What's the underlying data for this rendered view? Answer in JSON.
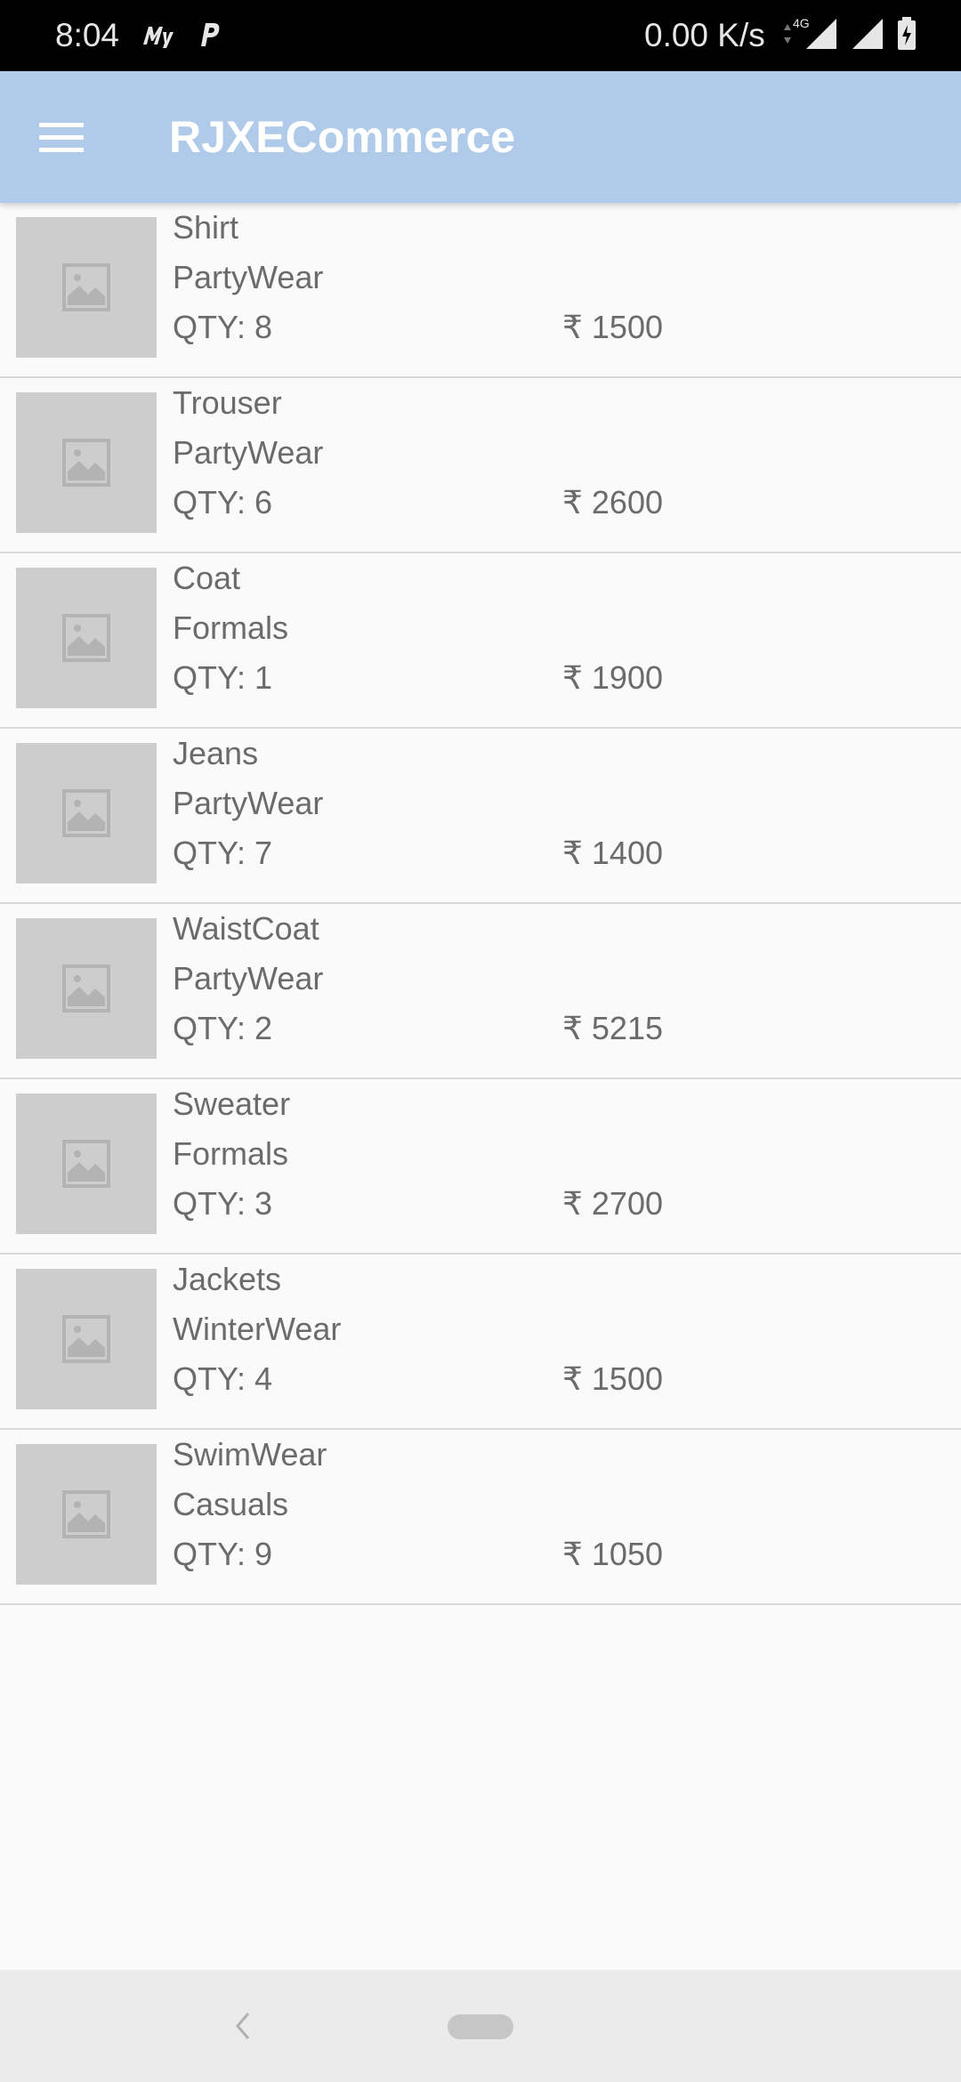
{
  "status_bar": {
    "time": "8:04",
    "network_speed": "0.00 K/s",
    "network_type": "4G",
    "icons": [
      "my-app-icon",
      "p-icon",
      "signal-4g-icon",
      "signal-icon",
      "battery-charging-icon"
    ]
  },
  "app_bar": {
    "title": "RJXECommerce",
    "menu_icon": "hamburger-menu-icon",
    "background": "#b0cbe9"
  },
  "products": [
    {
      "name": "Shirt",
      "category": "PartyWear",
      "qty": "QTY: 8",
      "price": "₹ 1500",
      "image_icon": "image-placeholder-icon"
    },
    {
      "name": "Trouser",
      "category": "PartyWear",
      "qty": "QTY: 6",
      "price": "₹ 2600",
      "image_icon": "image-placeholder-icon"
    },
    {
      "name": "Coat",
      "category": "Formals",
      "qty": "QTY: 1",
      "price": "₹ 1900",
      "image_icon": "image-placeholder-icon"
    },
    {
      "name": "Jeans",
      "category": "PartyWear",
      "qty": "QTY: 7",
      "price": "₹ 1400",
      "image_icon": "image-placeholder-icon"
    },
    {
      "name": "WaistCoat",
      "category": "PartyWear",
      "qty": "QTY: 2",
      "price": "₹ 5215",
      "image_icon": "image-placeholder-icon"
    },
    {
      "name": "Sweater",
      "category": "Formals",
      "qty": "QTY: 3",
      "price": "₹ 2700",
      "image_icon": "image-placeholder-icon"
    },
    {
      "name": "Jackets",
      "category": "WinterWear",
      "qty": "QTY: 4",
      "price": "₹ 1500",
      "image_icon": "image-placeholder-icon"
    },
    {
      "name": "SwimWear",
      "category": "Casuals",
      "qty": "QTY: 9",
      "price": "₹ 1050",
      "image_icon": "image-placeholder-icon"
    }
  ],
  "nav_bar": {
    "back_icon": "back-chevron-icon",
    "home_icon": "home-pill-icon"
  }
}
